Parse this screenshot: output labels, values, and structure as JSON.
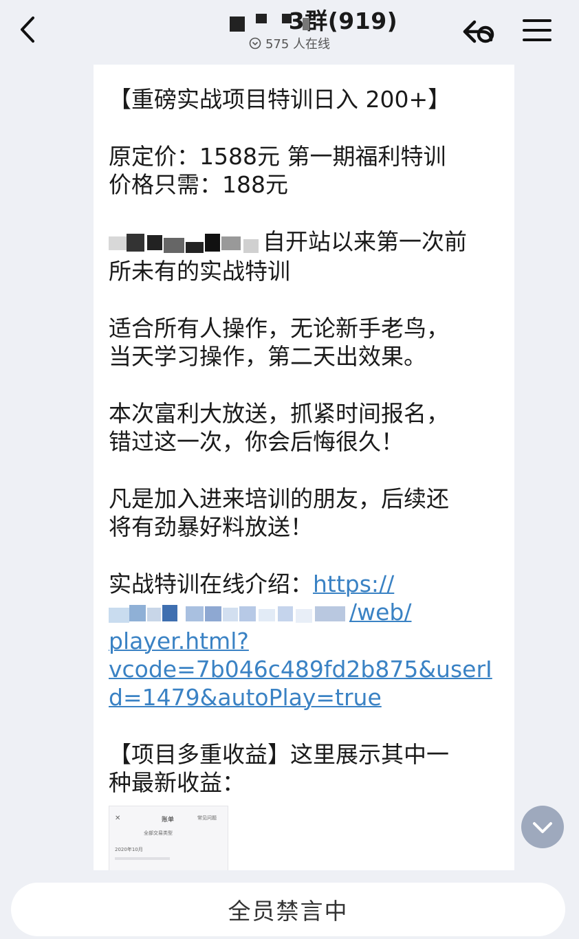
{
  "header": {
    "title_suffix": "3群(919)",
    "online_count": "575 人在线"
  },
  "message": {
    "heading": "【重磅实战项目特训日入 200+】",
    "price_line1": "原定价：1588元   第一期福利特训",
    "price_line2": "价格只需：188元",
    "intro_tail": "自开站以来第一次前",
    "intro_line2": "所未有的实战特训",
    "suit_line1": "适合所有人操作，无论新手老鸟，",
    "suit_line2": "当天学习操作，第二天出效果。",
    "promo_line1": "本次富利大放送，抓紧时间报名，",
    "promo_line2": "错过这一次，你会后悔很久！",
    "bonus_line1": "凡是加入进来培训的朋友，后续还",
    "bonus_line2": "将有劲暴好料放送！",
    "link_label": "实战特训在线介绍：",
    "link_part1": "https://",
    "link_part2": "/web/",
    "link_part3": "player.html?",
    "link_part4": "vcode=7b046c489fd2b875&userI",
    "link_part5": "d=1479&autoPlay=true",
    "earn_line1": "【项目多重收益】这里展示其中一",
    "earn_line2": "种最新收益："
  },
  "thumbnail": {
    "title": "账单",
    "right": "常见问题",
    "filter": "全部交易类型",
    "month": "2020年10月"
  },
  "footer": {
    "status": "全员禁言中"
  }
}
